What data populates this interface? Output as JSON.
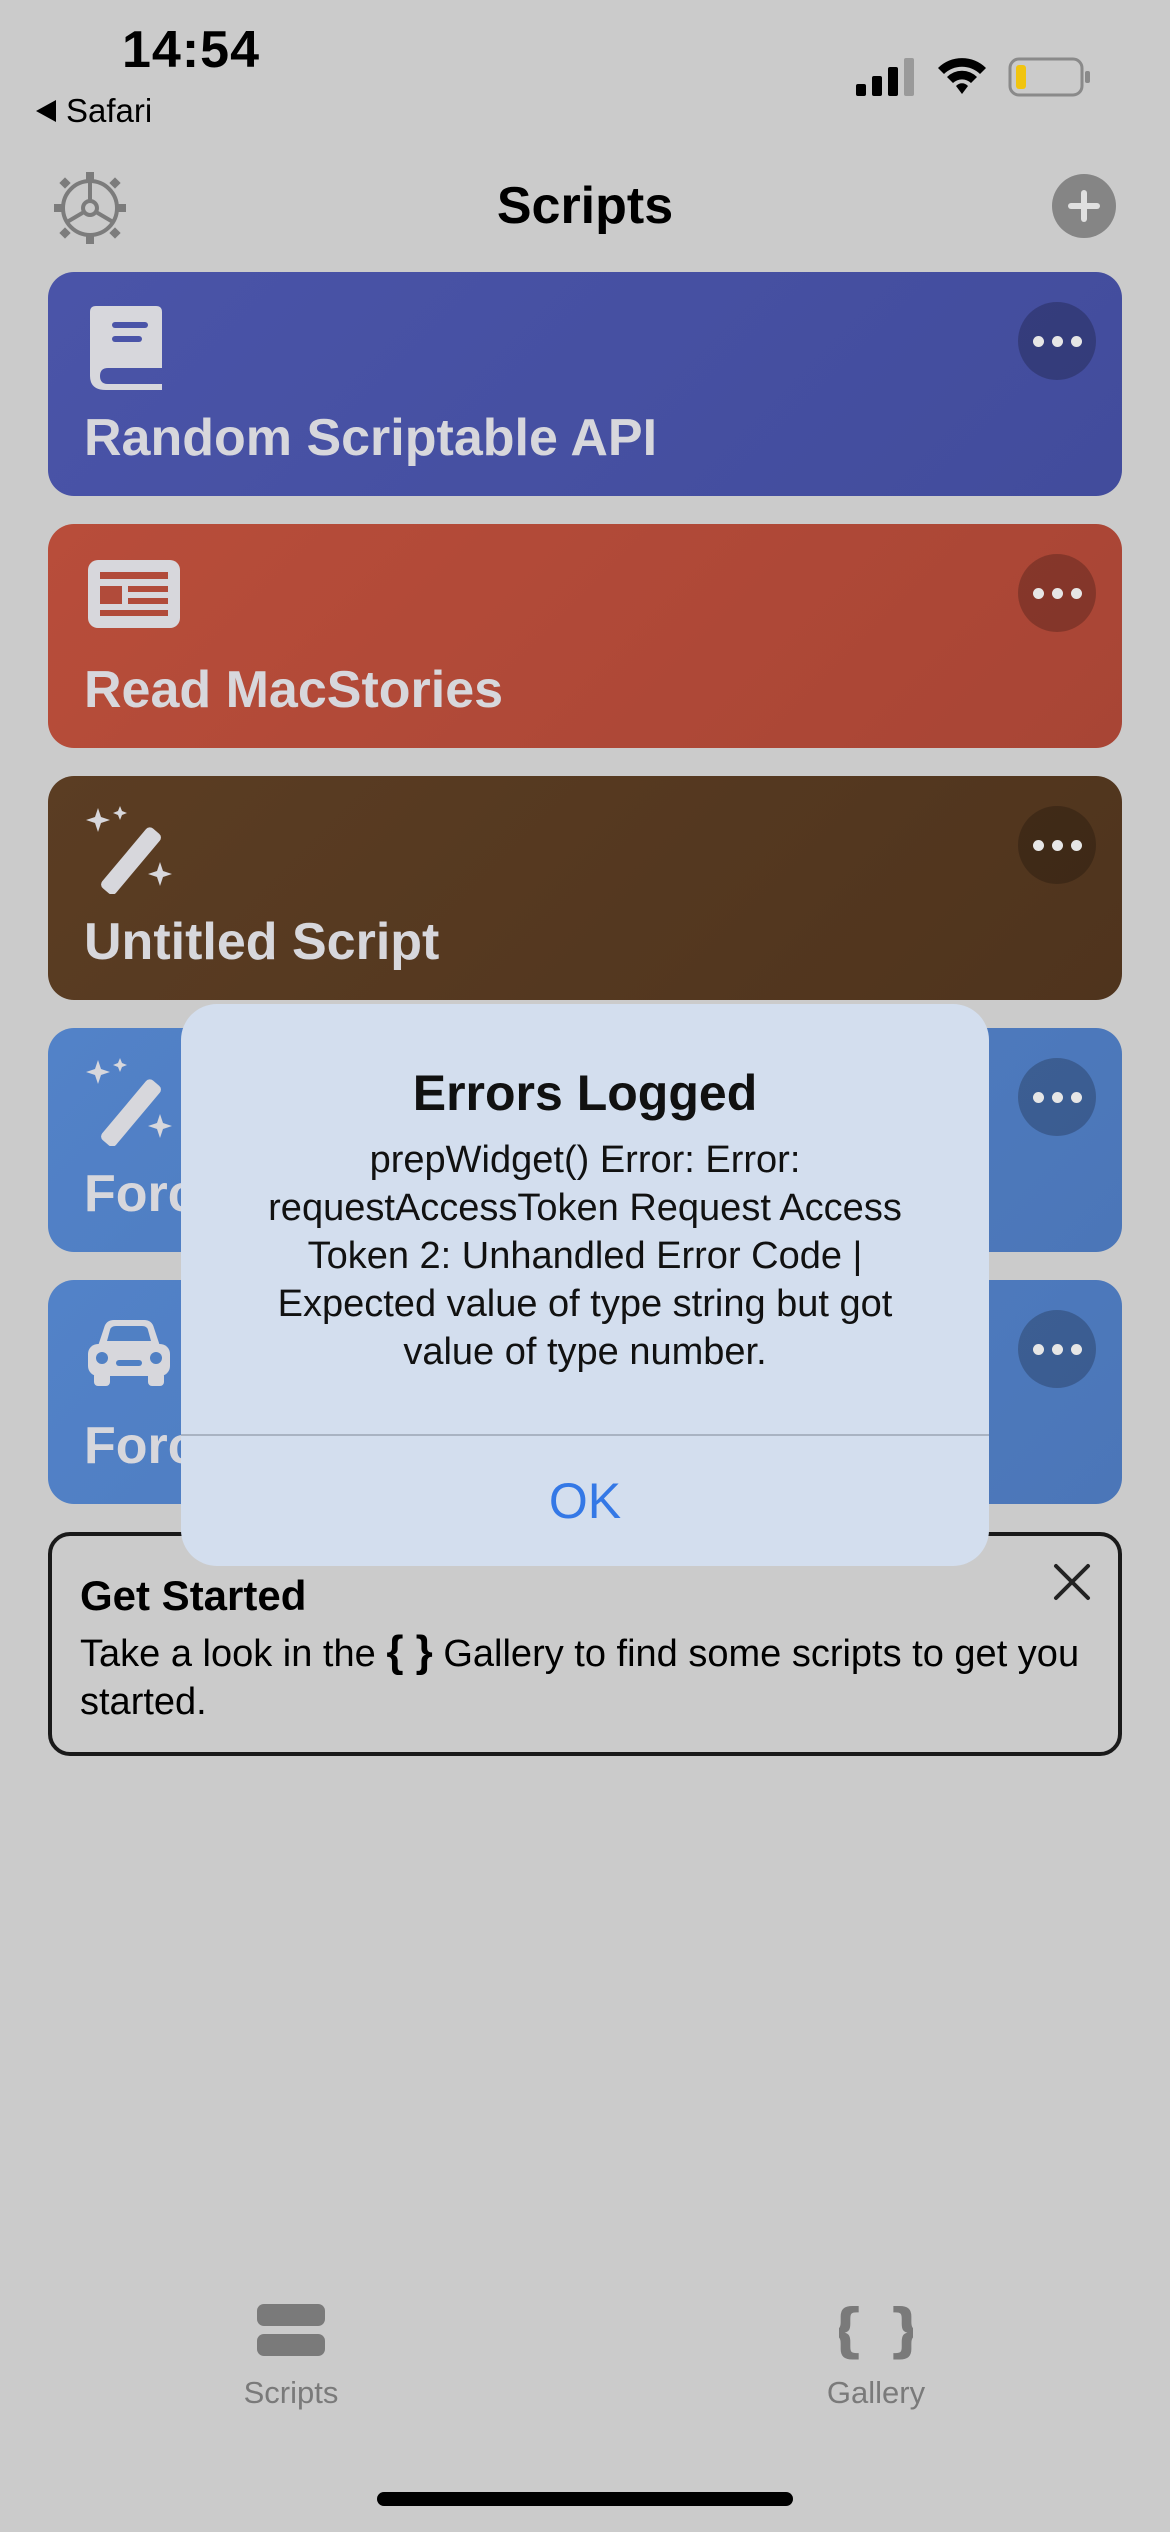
{
  "status_bar": {
    "time": "14:54",
    "back_label": "Safari",
    "icons": [
      "cellular-signal-icon",
      "wifi-icon",
      "battery-icon"
    ]
  },
  "nav": {
    "title": "Scripts",
    "left_icon": "gear-icon",
    "right_icon": "plus-icon"
  },
  "scripts": [
    {
      "label": "Random Scriptable API",
      "icon": "book-icon",
      "color": "#4a54a8"
    },
    {
      "label": "Read MacStories",
      "icon": "newspaper-icon",
      "color": "#b14b3a"
    },
    {
      "label": "Untitled Script",
      "icon": "magic-wand-icon",
      "color": "#573a22"
    },
    {
      "label": "Forc",
      "icon": "magic-wand-icon",
      "color": "#4f7bc0"
    },
    {
      "label": "Forc",
      "icon": "car-icon",
      "color": "#4f7bc0"
    }
  ],
  "get_started": {
    "title": "Get Started",
    "text_before": "Take a look in the ",
    "brace": "{ }",
    "text_after": " Gallery to find some scripts to get you started."
  },
  "dialog": {
    "title": "Errors Logged",
    "message": "prepWidget() Error: Error: requestAccessToken Request Access Token 2: Unhandled Error Code | Expected value of type string but got value of type number.",
    "ok_label": "OK"
  },
  "tab_bar": {
    "tabs": [
      {
        "label": "Scripts",
        "icon": "scripts-stack-icon"
      },
      {
        "label": "Gallery",
        "icon": "braces-icon"
      }
    ]
  },
  "colors": {
    "background": "#cbcbcb",
    "dialog_bg": "#d3deee",
    "accent_blue": "#3478e6",
    "battery_level": "#f1c40f"
  }
}
